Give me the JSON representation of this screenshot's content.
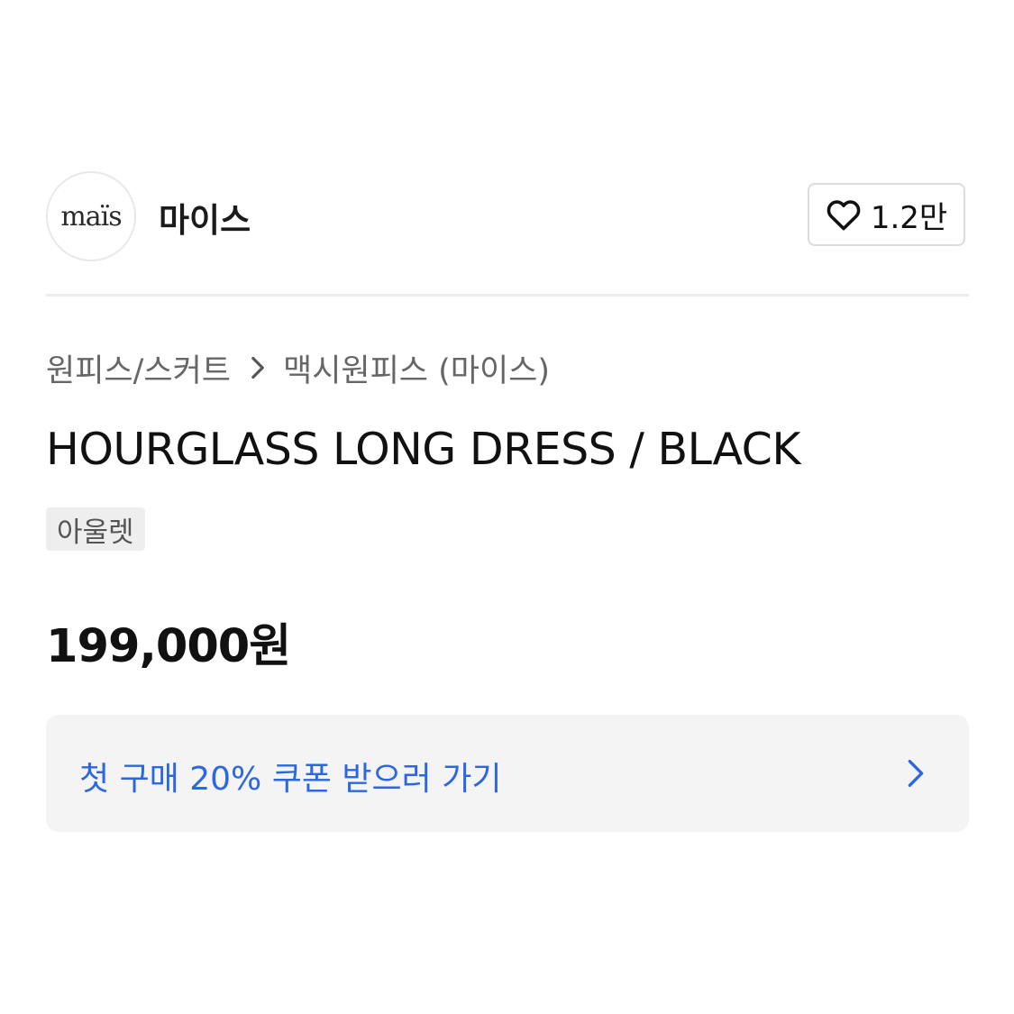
{
  "brand": {
    "logo_text": "maïs",
    "name": "마이스",
    "like_count": "1.2만",
    "like_icon": "heart-outline-icon"
  },
  "breadcrumb": {
    "category": "원피스/스커트",
    "separator_icon": "chevron-right-icon",
    "subcategory": "맥시원피스 (마이스)"
  },
  "product": {
    "title": "HOURGLASS LONG DRESS / BLACK",
    "tag": "아울렛",
    "price": "199,000원"
  },
  "coupon": {
    "text": "첫 구매 20% 쿠폰 받으러 가기",
    "icon": "chevron-right-icon",
    "text_color": "#2d67e0",
    "background": "#f4f4f4"
  }
}
